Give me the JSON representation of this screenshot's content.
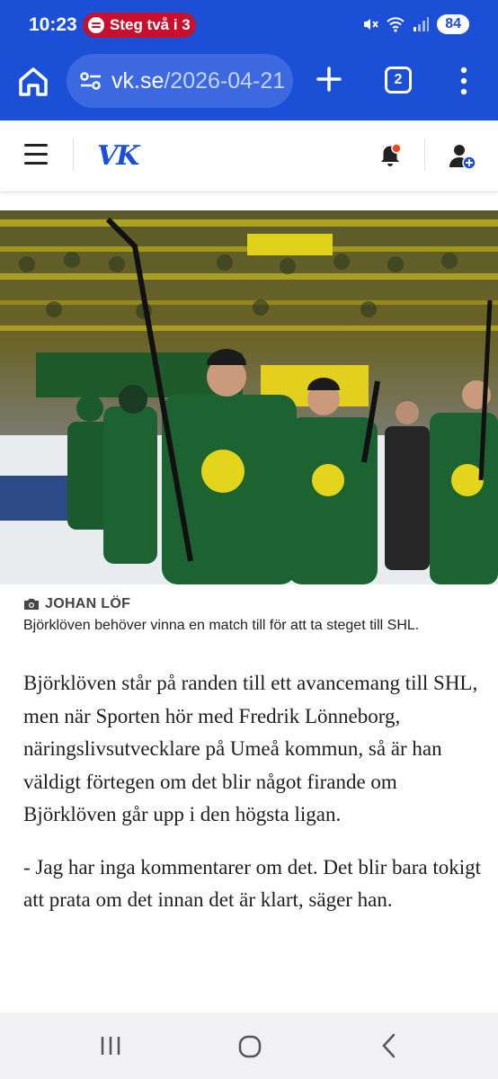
{
  "status_bar": {
    "time": "10:23",
    "media_pill": "Steg två i 3",
    "battery": "84",
    "icons": [
      "mute-icon",
      "wifi-icon",
      "signal-icon"
    ]
  },
  "browser": {
    "url_domain": "vk.se",
    "url_path": "/2026-04-21",
    "tab_count": "2",
    "accent_color": "#1a4fd6"
  },
  "site": {
    "logo": "VK",
    "icons": [
      "menu-icon",
      "notification-bell-icon",
      "user-account-icon"
    ]
  },
  "article": {
    "photo_credit": "JOHAN LÖF",
    "image_caption": "Björklöven behöver vinna en match till för att ta steget till SHL.",
    "paragraphs": [
      "Björklöven står på randen till ett avancemang till SHL, men när Sporten hör med Fredrik Lönneborg, näringslivsutvecklare på Umeå kommun, så är han väldigt förtegen om det blir något firande om Björklöven går upp i den högsta ligan.",
      "- Jag har inga kommentarer om det. Det blir bara tokigt att prata om det innan det är klart, säger han."
    ]
  },
  "nav": {
    "icons": [
      "recent-apps-icon",
      "home-icon",
      "back-icon"
    ]
  }
}
